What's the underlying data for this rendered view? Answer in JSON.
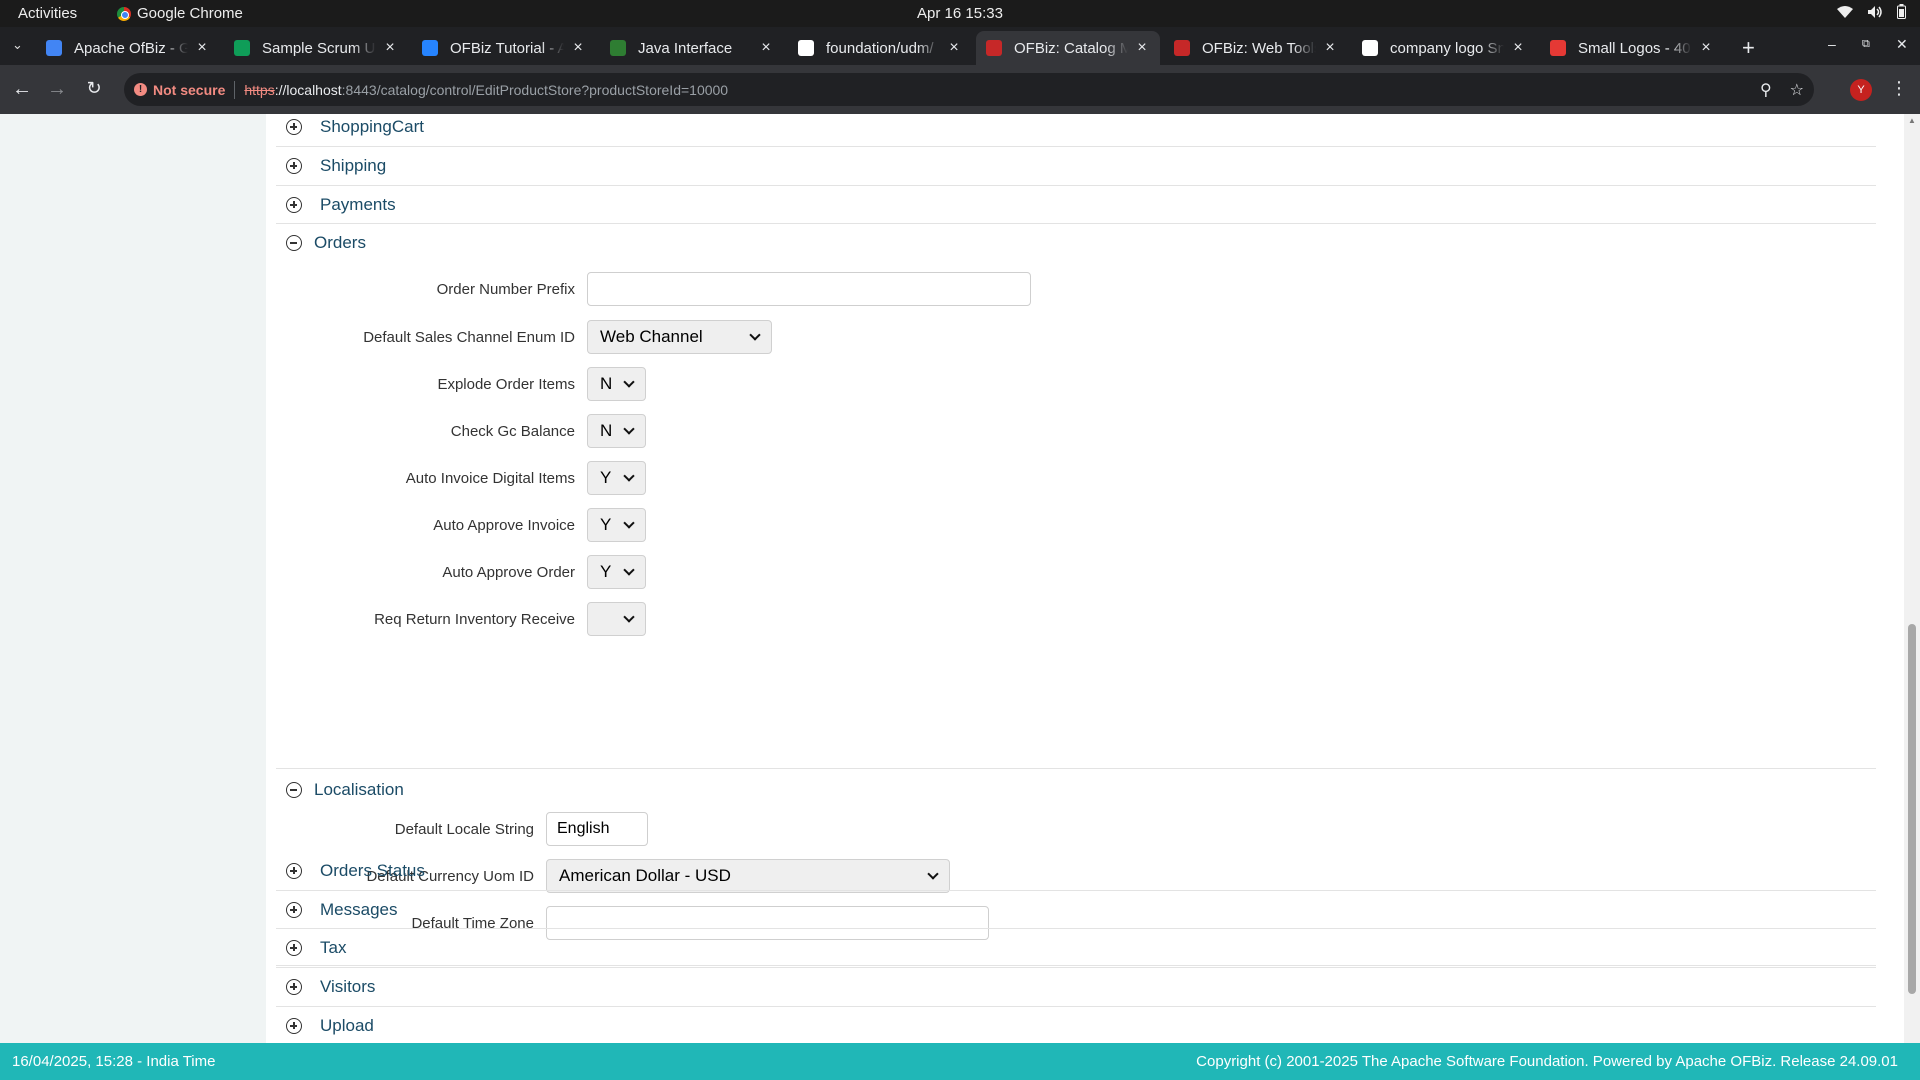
{
  "system": {
    "activities": "Activities",
    "app_name": "Google Chrome",
    "clock": "Apr 16  15:33"
  },
  "tabs": [
    {
      "title": "Apache OfBiz - G",
      "favicon": "docs-icon",
      "color": "#4285f4"
    },
    {
      "title": "Sample Scrum Up",
      "favicon": "sheets-icon",
      "color": "#0f9d58"
    },
    {
      "title": "OFBiz Tutorial - A",
      "favicon": "confluence-icon",
      "color": "#2684ff"
    },
    {
      "title": "Java Interface",
      "favicon": "w-icon",
      "color": "#2e7d32"
    },
    {
      "title": "foundation/udm/",
      "favicon": "github-icon",
      "color": "#ffffff"
    },
    {
      "title": "OFBiz: Catalog M",
      "favicon": "ofbiz-icon",
      "color": "#c62828",
      "active": true
    },
    {
      "title": "OFBiz: Web Tools",
      "favicon": "ofbiz-icon",
      "color": "#c62828"
    },
    {
      "title": "company logo Sn",
      "favicon": "google-icon",
      "color": "#ffffff"
    },
    {
      "title": "Small Logos - 40",
      "favicon": "logo-icon",
      "color": "#e53935"
    }
  ],
  "toolbar": {
    "security_label": "Not secure",
    "url_proto": "https",
    "url_host": "://localhost",
    "url_rest": ":8443/catalog/control/EditProductStore?productStoreId=10000",
    "profile_initial": "Y"
  },
  "sections": {
    "shopping_cart": "ShoppingCart",
    "shipping": "Shipping",
    "payments": "Payments",
    "orders": "Orders",
    "localisation": "Localisation",
    "orders_status": "Orders Status",
    "messages": "Messages",
    "tax": "Tax",
    "visitors": "Visitors",
    "upload": "Upload"
  },
  "orders": {
    "order_number_prefix": {
      "label": "Order Number Prefix",
      "value": ""
    },
    "default_sales_channel": {
      "label": "Default Sales Channel Enum ID",
      "value": "Web Channel"
    },
    "explode_order_items": {
      "label": "Explode Order Items",
      "value": "N"
    },
    "check_gc_balance": {
      "label": "Check Gc Balance",
      "value": "N"
    },
    "auto_invoice_digital": {
      "label": "Auto Invoice Digital Items",
      "value": "Y"
    },
    "auto_approve_invoice": {
      "label": "Auto Approve Invoice",
      "value": "Y"
    },
    "auto_approve_order": {
      "label": "Auto Approve Order",
      "value": "Y"
    },
    "req_return_inventory": {
      "label": "Req Return Inventory Receive",
      "value": ""
    }
  },
  "localisation": {
    "default_locale": {
      "label": "Default Locale String",
      "value": "English"
    },
    "default_currency": {
      "label": "Default Currency Uom ID",
      "value": "American Dollar - USD"
    },
    "default_time_zone": {
      "label": "Default Time Zone",
      "value": ""
    }
  },
  "footer": {
    "left": "16/04/2025, 15:28 - India Time",
    "right": "Copyright (c) 2001-2025 The Apache Software Foundation. Powered by Apache OFBiz. Release 24.09.01"
  },
  "colors": {
    "footer": "#20b7b7",
    "section_title": "#1b4b66"
  }
}
